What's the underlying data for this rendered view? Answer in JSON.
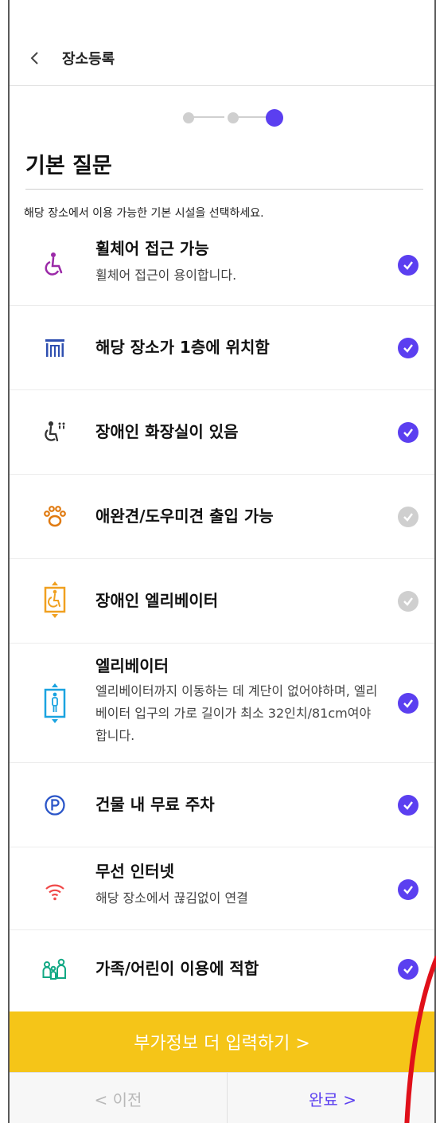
{
  "header": {
    "back_icon": "chevron-left-icon",
    "title": "장소등록"
  },
  "stepper": {
    "total": 3,
    "current": 3
  },
  "section": {
    "title": "기본 질문",
    "description": "해당 장소에서 이용 가능한 기본 시설을 선택하세요."
  },
  "items": [
    {
      "icon": "wheelchair-icon",
      "icon_color": "#9b2aa8",
      "title": "휠체어 접근 가능",
      "desc": "휠체어 접근이 용이합니다.",
      "checked": true
    },
    {
      "icon": "building-ground-floor-icon",
      "icon_color": "#2f4fb0",
      "title": "해당 장소가 1층에 위치함",
      "desc": "",
      "checked": true
    },
    {
      "icon": "accessible-restroom-icon",
      "icon_color": "#333333",
      "title": "장애인 화장실이 있음",
      "desc": "",
      "checked": true
    },
    {
      "icon": "paw-icon",
      "icon_color": "#e07a10",
      "title": "애완견/도우미견 출입 가능",
      "desc": "",
      "checked": false
    },
    {
      "icon": "accessible-elevator-icon",
      "icon_color": "#f0a020",
      "title": "장애인 엘리베이터",
      "desc": "",
      "checked": false
    },
    {
      "icon": "elevator-icon",
      "icon_color": "#1aa3e0",
      "title": "엘리베이터",
      "desc": "엘리베이터까지 이동하는 데 계단이 없어야하며, 엘리베이터 입구의 가로 길이가 최소 32인치/81cm여야 합니다.",
      "checked": true
    },
    {
      "icon": "parking-icon",
      "icon_color": "#2a55c8",
      "title": "건물 내 무료 주차",
      "desc": "",
      "checked": true
    },
    {
      "icon": "wifi-icon",
      "icon_color": "#f04848",
      "title": "무선 인터넷",
      "desc": "해당 장소에서 끊김없이 연결",
      "checked": true
    },
    {
      "icon": "family-icon",
      "icon_color": "#12a884",
      "title": "가족/어린이 이용에 적합",
      "desc": "",
      "checked": true
    }
  ],
  "cta": {
    "label": "부가정보 더 입력하기 >"
  },
  "footer": {
    "prev_label": "< 이전",
    "done_label": "완료 >"
  },
  "colors": {
    "accent": "#5b3ff0",
    "cta": "#f5c518",
    "unchecked": "#cfcfcf",
    "annotation": "#e0101a"
  }
}
